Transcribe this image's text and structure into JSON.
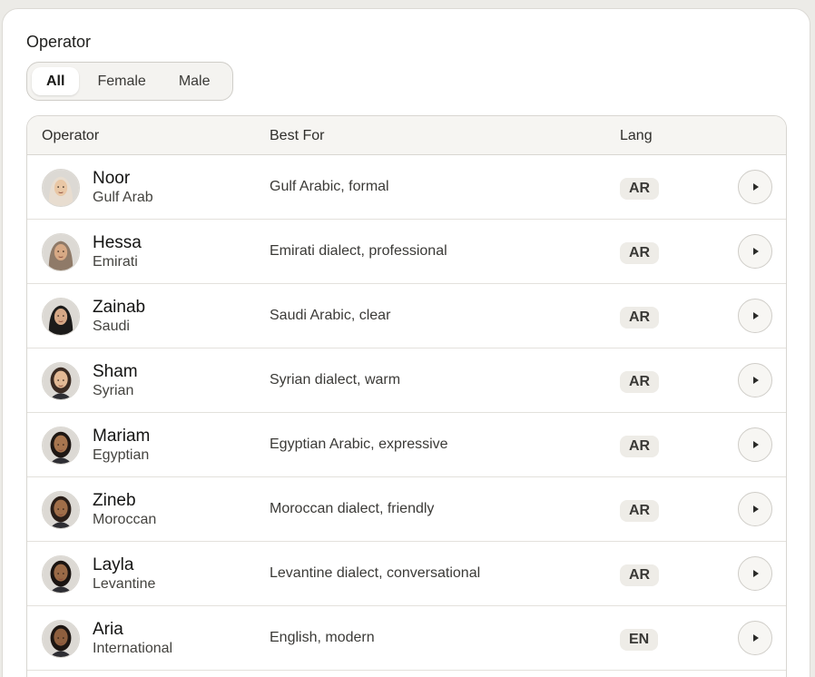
{
  "section": {
    "title": "Operator"
  },
  "filters": [
    {
      "label": "All",
      "active": true
    },
    {
      "label": "Female",
      "active": false
    },
    {
      "label": "Male",
      "active": false
    }
  ],
  "table": {
    "headers": {
      "operator": "Operator",
      "best_for": "Best For",
      "lang": "Lang"
    },
    "rows": [
      {
        "name": "Noor",
        "region": "Gulf Arab",
        "best_for": "Gulf Arabic, formal",
        "lang": "AR",
        "avatar": "hijab-light",
        "hijab": "#e8ddd0",
        "skin": "#e9c7a5"
      },
      {
        "name": "Hessa",
        "region": "Emirati",
        "best_for": "Emirati dialect, professional",
        "lang": "AR",
        "avatar": "hijab-tan",
        "hijab": "#8f7a68",
        "skin": "#d7a985"
      },
      {
        "name": "Zainab",
        "region": "Saudi",
        "best_for": "Saudi Arabic, clear",
        "lang": "AR",
        "avatar": "hijab-black",
        "hijab": "#1c1b1a",
        "skin": "#d6a886"
      },
      {
        "name": "Sham",
        "region": "Syrian",
        "best_for": "Syrian dialect, warm",
        "lang": "AR",
        "avatar": "hair-dark",
        "hijab": "#3a2a22",
        "skin": "#e3b995"
      },
      {
        "name": "Mariam",
        "region": "Egyptian",
        "best_for": "Egyptian Arabic, expressive",
        "lang": "AR",
        "avatar": "hair-black",
        "hijab": "#1e1713",
        "skin": "#a8764f"
      },
      {
        "name": "Zineb",
        "region": "Moroccan",
        "best_for": "Moroccan dialect, friendly",
        "lang": "AR",
        "avatar": "hair-bun",
        "hijab": "#2a1e18",
        "skin": "#a06e49"
      },
      {
        "name": "Layla",
        "region": "Levantine",
        "best_for": "Levantine dialect, conversational",
        "lang": "AR",
        "avatar": "hair-long",
        "hijab": "#1a1411",
        "skin": "#9a6a47"
      },
      {
        "name": "Aria",
        "region": "International",
        "best_for": "English, modern",
        "lang": "EN",
        "avatar": "hair-pulled",
        "hijab": "#1d1612",
        "skin": "#8e5f3e"
      }
    ]
  },
  "icons": {
    "play": "play-icon"
  }
}
